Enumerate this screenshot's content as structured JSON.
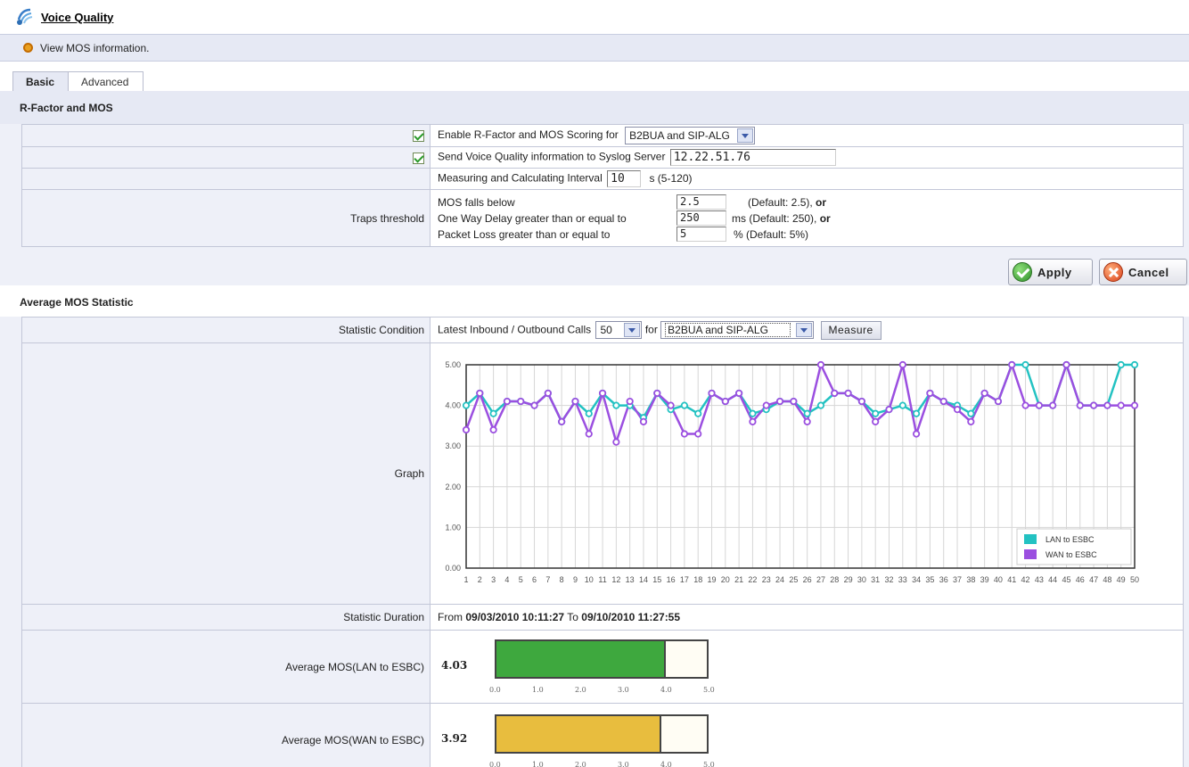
{
  "header": {
    "title": "Voice Quality"
  },
  "info": {
    "text": "View MOS information."
  },
  "tabs": [
    {
      "label": "Basic"
    },
    {
      "label": "Advanced"
    }
  ],
  "rfactor": {
    "section_title": "R-Factor and MOS",
    "enable_label": "Enable R-Factor and MOS Scoring for",
    "enable_checked": true,
    "enable_select": "B2BUA and SIP-ALG",
    "syslog_label": "Send Voice Quality information to Syslog Server",
    "syslog_checked": true,
    "syslog_value": "12.22.51.76",
    "interval_label": "Measuring and Calculating Interval",
    "interval_value": "10",
    "interval_unit": "s  (5-120)",
    "traps_label": "Traps threshold",
    "traps": [
      {
        "label": "MOS falls below",
        "value": "2.5",
        "desc_pre": "(Default: 2.5), ",
        "desc_bold": "or"
      },
      {
        "label": "One Way Delay greater than or equal to",
        "value": "250",
        "desc_pre": "ms (Default: 250), ",
        "desc_bold": "or"
      },
      {
        "label": "Packet Loss greater than or equal to",
        "value": "5",
        "desc_pre": "%  (Default: 5%)",
        "desc_bold": ""
      }
    ]
  },
  "buttons": {
    "apply": "Apply",
    "cancel": "Cancel"
  },
  "avg": {
    "section_title": "Average MOS Statistic",
    "condition_label": "Statistic Condition",
    "condition_text": "Latest Inbound / Outbound Calls",
    "calls_select": "50",
    "for_text": "for",
    "for_select": "B2BUA and SIP-ALG",
    "measure_label": "Measure",
    "graph_label": "Graph",
    "duration_label": "Statistic Duration",
    "duration_from": "From",
    "duration_start": "09/03/2010 10:11:27",
    "duration_to": "To",
    "duration_end": "09/10/2010 11:27:55",
    "lan_label": "Average MOS(LAN to ESBC)",
    "lan_value": "4.03",
    "lan_num": 4.03,
    "wan_label": "Average MOS(WAN to ESBC)",
    "wan_value": "3.92",
    "wan_num": 3.92,
    "bar_ticks": [
      "0.0",
      "1.0",
      "2.0",
      "3.0",
      "4.0",
      "5.0"
    ],
    "colors": {
      "lan_bar": "#3ea83e",
      "wan_bar": "#e8bd3e"
    }
  },
  "chart_data": {
    "type": "line",
    "x": [
      1,
      2,
      3,
      4,
      5,
      6,
      7,
      8,
      9,
      10,
      11,
      12,
      13,
      14,
      15,
      16,
      17,
      18,
      19,
      20,
      21,
      22,
      23,
      24,
      25,
      26,
      27,
      28,
      29,
      30,
      31,
      32,
      33,
      34,
      35,
      36,
      37,
      38,
      39,
      40,
      41,
      42,
      43,
      44,
      45,
      46,
      47,
      48,
      49,
      50
    ],
    "yticks": [
      "0.00",
      "1.00",
      "2.00",
      "3.00",
      "4.00",
      "5.00"
    ],
    "ylim": [
      0,
      5
    ],
    "grid": true,
    "legend_position": "bottom-right",
    "series": [
      {
        "name": "LAN to ESBC",
        "color": "#23c2c2",
        "values": [
          4.0,
          4.3,
          3.8,
          4.1,
          4.1,
          4.0,
          4.3,
          3.6,
          4.1,
          3.8,
          4.3,
          4.0,
          4.0,
          3.7,
          4.3,
          3.9,
          4.0,
          3.8,
          4.3,
          4.1,
          4.3,
          3.8,
          3.9,
          4.1,
          4.1,
          3.8,
          4.0,
          4.3,
          4.3,
          4.1,
          3.8,
          3.9,
          4.0,
          3.8,
          4.3,
          4.1,
          4.0,
          3.8,
          4.3,
          4.1,
          5.0,
          5.0,
          4.0,
          4.0,
          5.0,
          4.0,
          4.0,
          4.0,
          5.0,
          5.0
        ]
      },
      {
        "name": "WAN to ESBC",
        "color": "#9b4fe0",
        "values": [
          3.4,
          4.3,
          3.4,
          4.1,
          4.1,
          4.0,
          4.3,
          3.6,
          4.1,
          3.3,
          4.3,
          3.1,
          4.1,
          3.6,
          4.3,
          4.0,
          3.3,
          3.3,
          4.3,
          4.1,
          4.3,
          3.6,
          4.0,
          4.1,
          4.1,
          3.6,
          5.0,
          4.3,
          4.3,
          4.1,
          3.6,
          3.9,
          5.0,
          3.3,
          4.3,
          4.1,
          3.9,
          3.6,
          4.3,
          4.1,
          5.0,
          4.0,
          4.0,
          4.0,
          5.0,
          4.0,
          4.0,
          4.0,
          4.0,
          4.0
        ]
      }
    ]
  }
}
